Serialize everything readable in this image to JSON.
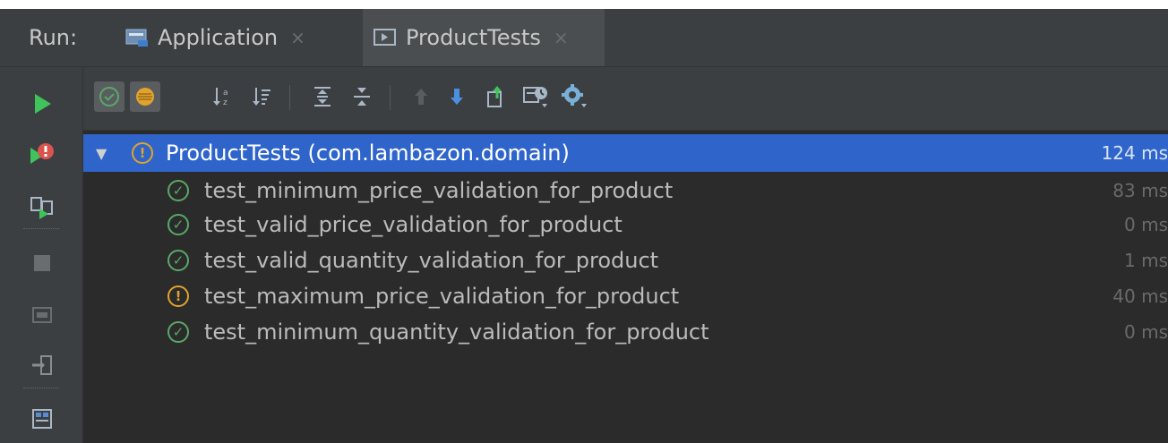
{
  "header": {
    "run_label": "Run:",
    "tabs": [
      {
        "label": "Application",
        "close": "×"
      },
      {
        "label": "ProductTests",
        "close": "×"
      }
    ]
  },
  "suite": {
    "toggle": "▼",
    "name": "ProductTests (com.lambazon.domain)",
    "time": "124 ms"
  },
  "tests": [
    {
      "name": "test_minimum_price_validation_for_product",
      "time": "83 ms",
      "status": "passed"
    },
    {
      "name": "test_valid_price_validation_for_product",
      "time": "0 ms",
      "status": "passed"
    },
    {
      "name": "test_valid_quantity_validation_for_product",
      "time": "1 ms",
      "status": "passed"
    },
    {
      "name": "test_maximum_price_validation_for_product",
      "time": "40 ms",
      "status": "failed"
    },
    {
      "name": "test_minimum_quantity_validation_for_product",
      "time": "0 ms",
      "status": "passed"
    }
  ],
  "icons": {
    "pass": "✓",
    "warn": "!"
  },
  "colors": {
    "selection": "#2f65ca",
    "passed": "#59a869",
    "failed": "#e0a32e",
    "run": "#3fc35b"
  }
}
